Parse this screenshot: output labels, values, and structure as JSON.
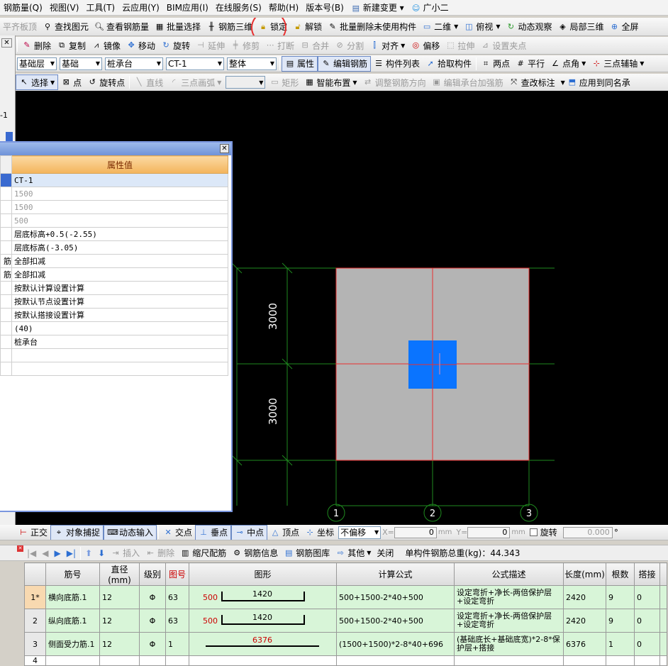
{
  "menu": [
    "钢筋量(Q)",
    "视图(V)",
    "工具(T)",
    "云应用(Y)",
    "BIM应用(I)",
    "在线服务(S)",
    "帮助(H)",
    "版本号(B)",
    "新建变更 ▾",
    "广小二"
  ],
  "toolbar1": {
    "items": [
      "平齐板顶",
      "查找图元",
      "查看钢筋量",
      "批量选择",
      "钢筋三维",
      "锁定",
      "解锁",
      "批量删除未使用构件",
      "二维",
      "俯视",
      "动态观察",
      "局部三维",
      "全屏"
    ]
  },
  "toolbar2": {
    "items": [
      "删除",
      "复制",
      "镜像",
      "移动",
      "旋转",
      "延伸",
      "修剪",
      "打断",
      "合并",
      "分割",
      "对齐",
      "偏移",
      "拉伸",
      "设置夹点"
    ]
  },
  "toolbar3": {
    "floor": "基础层",
    "category": "基础",
    "type": "桩承台",
    "component": "CT-1",
    "scope": "整体",
    "items": [
      "属性",
      "编辑钢筋",
      "构件列表",
      "拾取构件",
      "两点",
      "平行",
      "点角",
      "三点辅轴"
    ]
  },
  "toolbar4": {
    "items": [
      "选择",
      "点",
      "旋转点",
      "直线",
      "三点画弧",
      "矩形",
      "智能布置",
      "调整钢筋方向",
      "编辑承台加强筋",
      "查改标注",
      "应用到同名承"
    ]
  },
  "left_strip": {
    "label1": "-1"
  },
  "properties": {
    "header": "属性值",
    "rows": [
      {
        "prefix": "",
        "value": "CT-1",
        "gray": false
      },
      {
        "prefix": "",
        "value": "1500",
        "gray": true
      },
      {
        "prefix": "",
        "value": "1500",
        "gray": true
      },
      {
        "prefix": "",
        "value": "500",
        "gray": true
      },
      {
        "prefix": "",
        "value": "层底标高+0.5(-2.55)",
        "gray": false
      },
      {
        "prefix": "",
        "value": "层底标高(-3.05)",
        "gray": false
      },
      {
        "prefix": "筋",
        "value": "全部扣减",
        "gray": false
      },
      {
        "prefix": "筋",
        "value": "全部扣减",
        "gray": false
      },
      {
        "prefix": "",
        "value": "按默认计算设置计算",
        "gray": false
      },
      {
        "prefix": "",
        "value": "按默认节点设置计算",
        "gray": false
      },
      {
        "prefix": "",
        "value": "按默认搭接设置计算",
        "gray": false
      },
      {
        "prefix": "",
        "value": "(40)",
        "gray": false
      },
      {
        "prefix": "",
        "value": "桩承台",
        "gray": false
      },
      {
        "prefix": "",
        "value": "",
        "gray": false
      },
      {
        "prefix": "",
        "value": "",
        "gray": false
      }
    ]
  },
  "canvas": {
    "dim1": "3000",
    "dim2": "3000",
    "axes": [
      "1",
      "2",
      "3"
    ]
  },
  "snap_bar": {
    "items": [
      "正交",
      "对象捕捉",
      "动态输入",
      "交点",
      "垂点",
      "中点",
      "顶点",
      "坐标"
    ],
    "offset": "不偏移",
    "x_label": "X=",
    "x_value": "0",
    "y_label": "Y=",
    "y_value": "0",
    "unit": "mm",
    "rotate_label": "旋转",
    "rotate_value": "0.000",
    "degree": "°"
  },
  "rebar_bar": {
    "items": [
      "插入",
      "删除",
      "缩尺配筋",
      "钢筋信息",
      "钢筋图库",
      "其他",
      "关闭"
    ],
    "total": "单构件钢筋总重(kg)：44.343"
  },
  "rebar_table": {
    "columns": [
      "",
      "筋号",
      "直径(mm)",
      "级别",
      "图号",
      "图形",
      "计算公式",
      "公式描述",
      "长度(mm)",
      "根数",
      "搭接",
      ""
    ],
    "rows": [
      {
        "no": "1*",
        "name": "横向底筋.1",
        "dia": "12",
        "grade": "Φ",
        "fig": "63",
        "shape_left": "500",
        "shape_len": "1420",
        "formula": "500+1500-2*40+500",
        "desc": "设定弯折+净长-两倍保护层+设定弯折",
        "length": "2420",
        "count": "9",
        "lap": "0"
      },
      {
        "no": "2",
        "name": "纵向底筋.1",
        "dia": "12",
        "grade": "Φ",
        "fig": "63",
        "shape_left": "500",
        "shape_len": "1420",
        "formula": "500+1500-2*40+500",
        "desc": "设定弯折+净长-两倍保护层+设定弯折",
        "length": "2420",
        "count": "9",
        "lap": "0"
      },
      {
        "no": "3",
        "name": "侧面受力筋.1",
        "dia": "12",
        "grade": "Φ",
        "fig": "1",
        "shape_left": "",
        "shape_len": "6376",
        "formula": "(1500+1500)*2-8*40+696",
        "desc": "(基础底长+基础底宽)*2-8*保护层+搭接",
        "length": "6376",
        "count": "1",
        "lap": "0"
      },
      {
        "no": "4",
        "name": "",
        "dia": "",
        "grade": "",
        "fig": "",
        "shape_left": "",
        "shape_len": "",
        "formula": "",
        "desc": "",
        "length": "",
        "count": "",
        "lap": ""
      }
    ]
  }
}
